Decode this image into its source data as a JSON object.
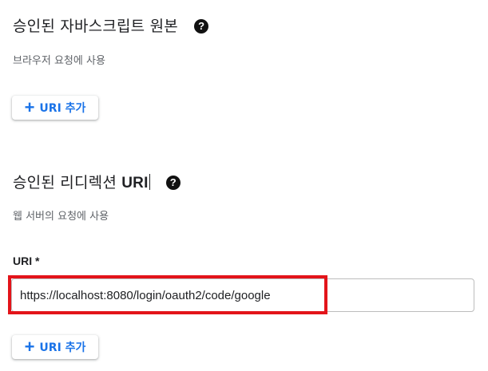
{
  "authorized_js_origins": {
    "title": "승인된 자바스크립트 원본",
    "help_icon": "help-circle-icon",
    "description": "브라우저 요청에 사용",
    "add_button_label": "URI 추가"
  },
  "authorized_redirect_uris": {
    "title_prefix": "승인된 리디렉션 ",
    "title_suffix": "URI",
    "help_icon": "help-circle-icon",
    "description": "웹 서버의 요청에 사용",
    "field_label": "URI *",
    "uri_value": "https://localhost:8080/login/oauth2/code/google",
    "add_button_label": "URI 추가"
  },
  "colors": {
    "accent": "#1a73e8",
    "highlight": "#e3141a",
    "secondary_text": "#5f6368"
  }
}
